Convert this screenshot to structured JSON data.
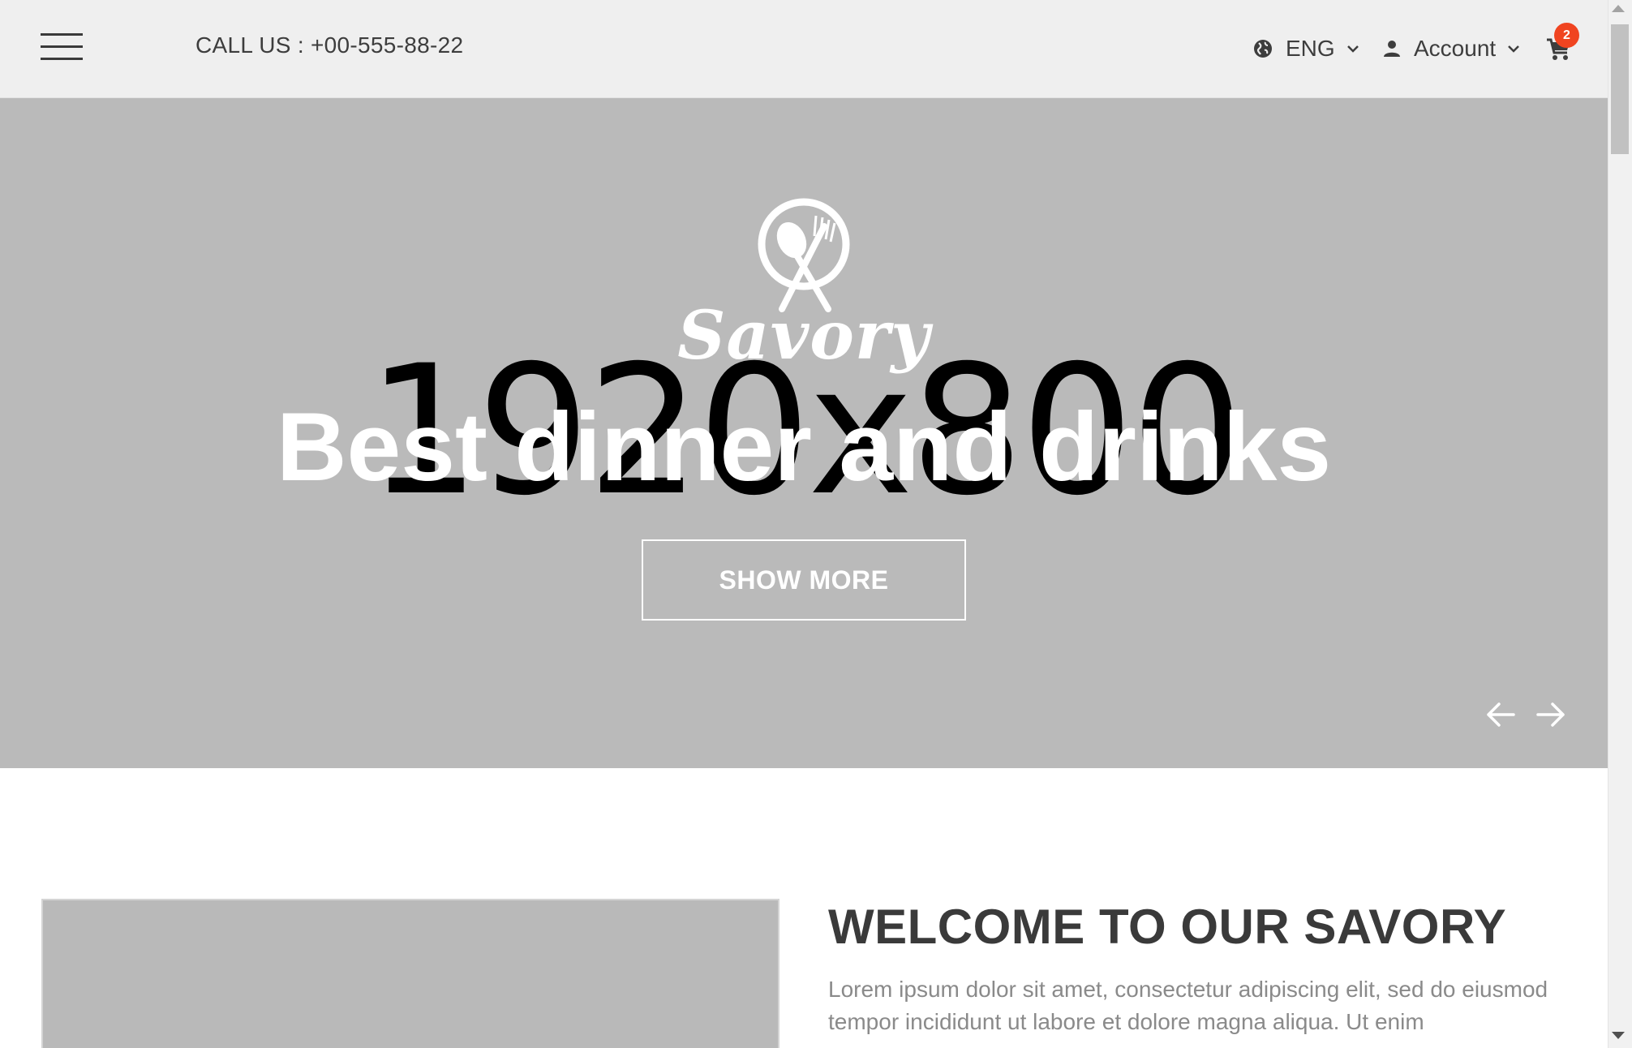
{
  "header": {
    "call_label": "CALL US : +00-555-88-22",
    "language": "ENG",
    "account": "Account",
    "cart_count": "2"
  },
  "hero": {
    "placeholder": "1920x800",
    "logo_text": "Savory",
    "title": "Best dinner and drinks",
    "button": "SHOW MORE"
  },
  "welcome": {
    "title": "WELCOME TO OUR SAVORY",
    "text": "Lorem ipsum dolor sit amet, consectetur adipiscing elit, sed do eiusmod tempor incididunt ut labore et dolore magna aliqua. Ut enim"
  },
  "colors": {
    "topbar": "#efefef",
    "hero_bg": "#bababa",
    "badge": "#f04420",
    "text_dark": "#3a3a3a",
    "text_muted": "#8a8a8a"
  },
  "icons": {
    "menu": "hamburger-icon",
    "language": "globe-icon",
    "account": "person-icon",
    "cart": "cart-icon",
    "prev": "arrow-left-icon",
    "next": "arrow-right-icon"
  }
}
